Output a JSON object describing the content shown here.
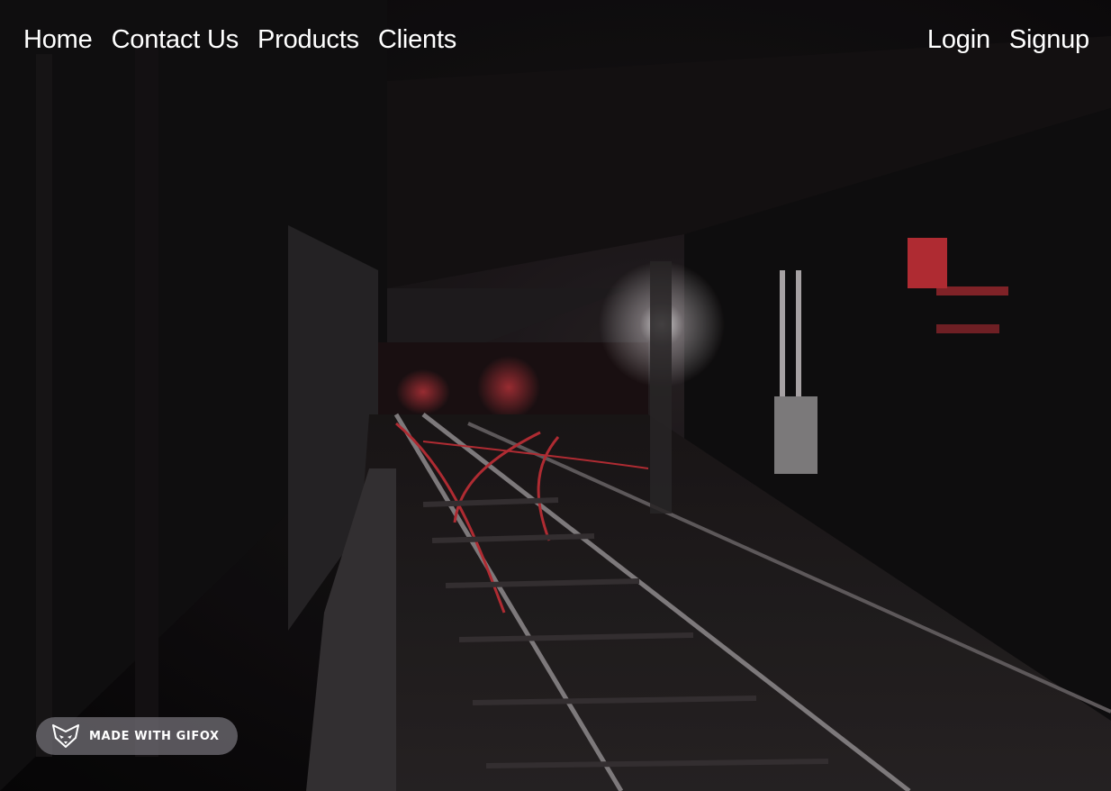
{
  "nav": {
    "left_links": [
      {
        "label": "Home"
      },
      {
        "label": "Contact Us"
      },
      {
        "label": "Products"
      },
      {
        "label": "Clients"
      }
    ],
    "right_links": [
      {
        "label": "Login"
      },
      {
        "label": "Signup"
      }
    ]
  },
  "hero": {
    "image_subject": "dark subway tunnel with railway tracks and red signal lights"
  },
  "badge": {
    "label": "MADE WITH GIFOX",
    "icon": "fox-icon"
  },
  "colors": {
    "nav_text": "#ffffff",
    "accent_red": "#c8323a",
    "badge_bg": "#6e6c72"
  }
}
